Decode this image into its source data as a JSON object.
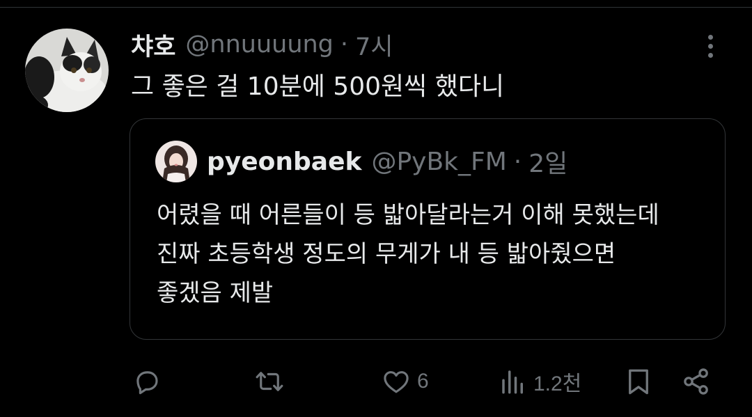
{
  "tweet": {
    "author": {
      "display_name": "챠호",
      "handle": "@nnuuuung",
      "avatar": "cat-avatar"
    },
    "separator": "·",
    "time": "7시",
    "text": "그 좋은 걸 10분에 500원씩 했다니",
    "more_icon": "more-vertical-icon"
  },
  "quote": {
    "author": {
      "display_name": "pyeonbaek",
      "handle": "@PyBk_FM",
      "avatar": "person-avatar"
    },
    "separator": "·",
    "time": "2일",
    "lines": [
      "어렸을 때 어른들이 등 밟아달라는거 이해 못했는데",
      "진짜 초등학생 정도의 무게가 내 등 밟아줬으면",
      "좋겠음 제발"
    ]
  },
  "actions": {
    "reply": {
      "icon": "reply-icon",
      "count": ""
    },
    "retweet": {
      "icon": "retweet-icon",
      "count": ""
    },
    "like": {
      "icon": "heart-icon",
      "count": "6"
    },
    "views": {
      "icon": "views-icon",
      "count": "1.2천"
    },
    "bookmark": {
      "icon": "bookmark-icon"
    },
    "share": {
      "icon": "share-icon"
    }
  },
  "colors": {
    "background": "#000000",
    "text_primary": "#e7e9ea",
    "text_secondary": "#71767b",
    "border": "#333639"
  }
}
